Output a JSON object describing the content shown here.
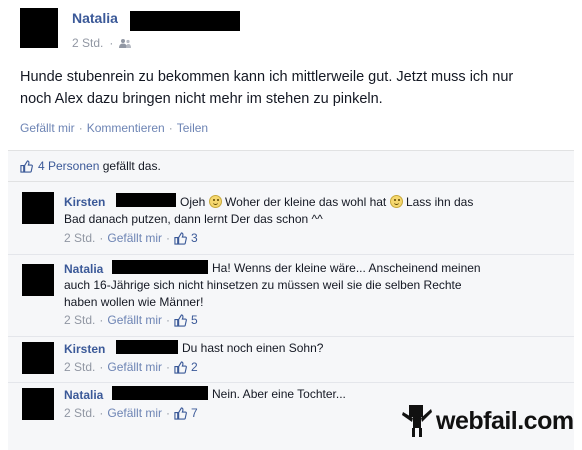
{
  "post": {
    "author": "Natalia",
    "time": "2 Std.",
    "audience_icon": "friends-icon",
    "text": "Hunde stubenrein zu bekommen kann ich mittlerweile gut. Jetzt muss ich nur noch Alex dazu bringen nicht mehr im stehen zu pinkeln.",
    "actions": {
      "like": "Gefällt mir",
      "comment": "Kommentieren",
      "share": "Teilen",
      "separator": "·"
    }
  },
  "likes": {
    "count_label": "4 Personen",
    "suffix": "gefällt das."
  },
  "comments": [
    {
      "author": "Kirsten",
      "text_a": "Ojeh",
      "text_b": "Woher der kleine das wohl hat",
      "text_c": "Lass ihn das",
      "text_d": "Bad danach putzen, dann lernt Der das schon ^^",
      "time": "2 Std.",
      "like": "Gefällt mir",
      "likes": "3"
    },
    {
      "author": "Natalia",
      "text_a": "Ha! Wenns der kleine wäre... Anscheinend meinen",
      "text_b": "auch 16-Jährige sich nicht hinsetzen zu müssen weil sie die selben Rechte",
      "text_c": "haben wollen wie Männer!",
      "time": "2 Std.",
      "like": "Gefällt mir",
      "likes": "5"
    },
    {
      "author": "Kirsten",
      "text_a": "Du hast noch einen Sohn?",
      "time": "2 Std.",
      "like": "Gefällt mir",
      "likes": "2"
    },
    {
      "author": "Natalia",
      "text_a": "Nein. Aber eine Tochter...",
      "time": "2 Std.",
      "like": "Gefällt mir",
      "likes": "7"
    }
  ],
  "watermark": {
    "logo_text": "webfail.com"
  },
  "colors": {
    "link": "#3b5998",
    "muted": "#9197a3",
    "panel": "#f6f7f9"
  }
}
